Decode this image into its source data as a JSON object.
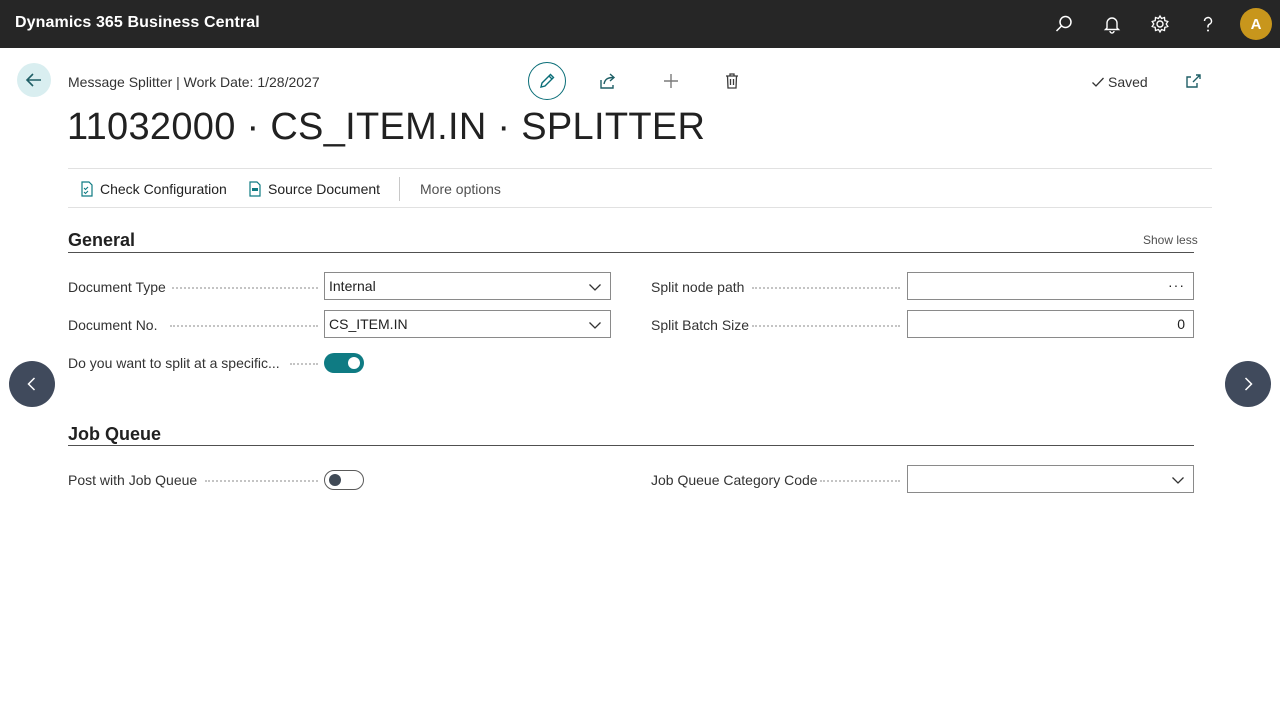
{
  "app": {
    "title": "Dynamics 365 Business Central",
    "avatar_initial": "A",
    "icons": [
      "search-icon",
      "bell-icon",
      "gear-icon",
      "help-icon"
    ]
  },
  "header": {
    "breadcrumb": "Message Splitter | Work Date: 1/28/2027",
    "saved_label": "Saved",
    "title": "11032000 · CS_ITEM.IN · SPLITTER",
    "accent_color": "#0f7b83"
  },
  "actions": {
    "check_configuration": "Check Configuration",
    "source_document": "Source Document",
    "more_options": "More options"
  },
  "general": {
    "title": "General",
    "show_less": "Show less",
    "document_type_label": "Document Type",
    "document_type_value": "Internal",
    "document_no_label": "Document No.",
    "document_no_value": "CS_ITEM.IN",
    "split_specific_label": "Do you want to split at a specific...",
    "split_specific_on": true,
    "split_node_path_label": "Split node path",
    "split_node_path_value": "",
    "split_batch_size_label": "Split Batch Size",
    "split_batch_size_value": "0"
  },
  "job_queue": {
    "title": "Job Queue",
    "post_with_job_queue_label": "Post with Job Queue",
    "post_with_job_queue_on": false,
    "category_code_label": "Job Queue Category Code",
    "category_code_value": ""
  }
}
